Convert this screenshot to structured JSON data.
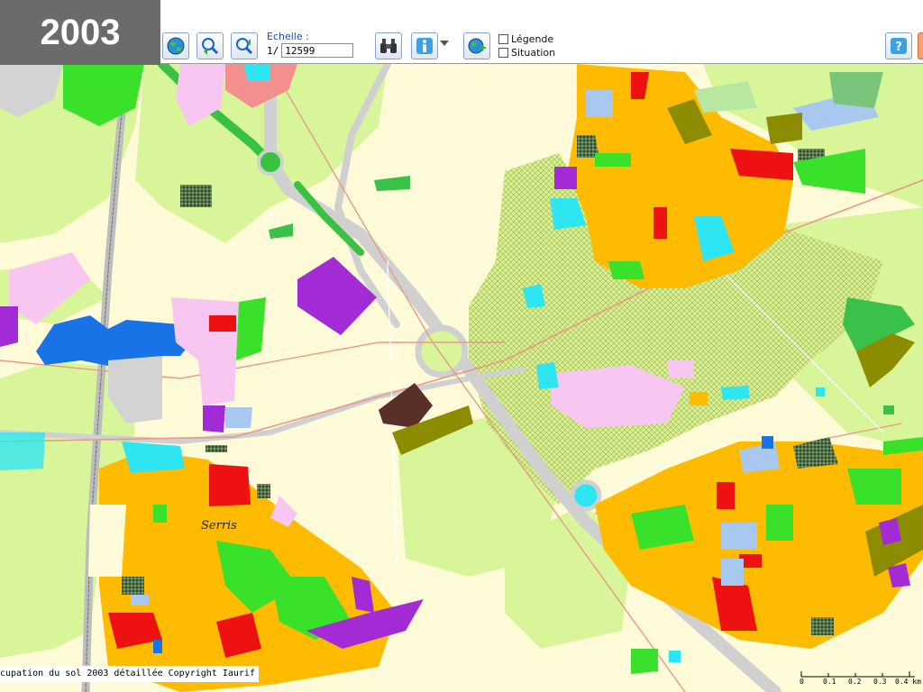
{
  "badge": {
    "year": "2003"
  },
  "toolbar": {
    "scale_label": "Echelle :",
    "scale_prefix": "1/",
    "scale_value": "12599",
    "legend_label": "Légende",
    "situation_label": "Situation",
    "buttons": [
      "globe-icon",
      "zoom-in-icon",
      "zoom-out-icon",
      "binoculars-icon",
      "info-icon",
      "globe-add-icon",
      "help-icon"
    ]
  },
  "map": {
    "place_label": "Serris",
    "copyright": "cupation du sol 2003 détaillée Copyright Iaurif",
    "scalebar": {
      "ticks": [
        "0",
        "0.1",
        "0.2",
        "0.3",
        "0.4 km"
      ]
    }
  },
  "colors": {
    "background": "#fffbd9",
    "light_green": "#d9f59a",
    "green": "#39e12b",
    "orange": "#ffbb00",
    "red": "#ee1111",
    "purple": "#a32bd6",
    "blue": "#1773e6",
    "cyan": "#2ee6f2",
    "pink": "#f7c7f1",
    "olive": "#8c8c00",
    "brown": "#5a2f2a",
    "grey": "#d3d3d3"
  }
}
